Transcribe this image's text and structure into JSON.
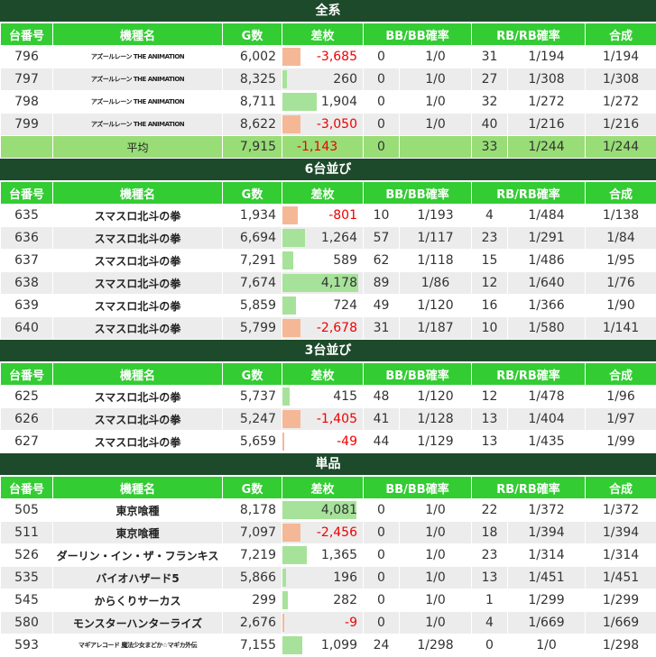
{
  "headers": [
    "台番号",
    "機種名",
    "G数",
    "差枚",
    "BB/BB確率",
    "RB/RB確率",
    "合成"
  ],
  "sections": [
    {
      "title": "全系",
      "rows": [
        {
          "no": "796",
          "name": "アズールレーン THE ANIMATION",
          "g": "6,002",
          "diff": "-3,685",
          "diff_value": -3685,
          "bb": "0",
          "bb_rate": "1/0",
          "rb": "31",
          "rb_rate": "1/194",
          "total": "1/194"
        },
        {
          "no": "797",
          "name": "アズールレーン THE ANIMATION",
          "g": "8,325",
          "diff": "260",
          "diff_value": 260,
          "bb": "0",
          "bb_rate": "1/0",
          "rb": "27",
          "rb_rate": "1/308",
          "total": "1/308"
        },
        {
          "no": "798",
          "name": "アズールレーン THE ANIMATION",
          "g": "8,711",
          "diff": "1,904",
          "diff_value": 1904,
          "bb": "0",
          "bb_rate": "1/0",
          "rb": "32",
          "rb_rate": "1/272",
          "total": "1/272"
        },
        {
          "no": "799",
          "name": "アズールレーン THE ANIMATION",
          "g": "8,622",
          "diff": "-3,050",
          "diff_value": -3050,
          "bb": "0",
          "bb_rate": "1/0",
          "rb": "40",
          "rb_rate": "1/216",
          "total": "1/216"
        }
      ],
      "average": {
        "label": "平均",
        "g": "7,915",
        "diff": "-1,143",
        "bb": "0",
        "rb": "33",
        "rb_rate": "1/244",
        "total": "1/244"
      }
    },
    {
      "title": "6台並び",
      "rows": [
        {
          "no": "635",
          "name": "スマスロ北斗の拳",
          "g": "1,934",
          "diff": "-801",
          "diff_value": -801,
          "bb": "10",
          "bb_rate": "1/193",
          "rb": "4",
          "rb_rate": "1/484",
          "total": "1/138"
        },
        {
          "no": "636",
          "name": "スマスロ北斗の拳",
          "g": "6,694",
          "diff": "1,264",
          "diff_value": 1264,
          "bb": "57",
          "bb_rate": "1/117",
          "rb": "23",
          "rb_rate": "1/291",
          "total": "1/84"
        },
        {
          "no": "637",
          "name": "スマスロ北斗の拳",
          "g": "7,291",
          "diff": "589",
          "diff_value": 589,
          "bb": "62",
          "bb_rate": "1/118",
          "rb": "15",
          "rb_rate": "1/486",
          "total": "1/95"
        },
        {
          "no": "638",
          "name": "スマスロ北斗の拳",
          "g": "7,674",
          "diff": "4,178",
          "diff_value": 4178,
          "bb": "89",
          "bb_rate": "1/86",
          "rb": "12",
          "rb_rate": "1/640",
          "total": "1/76"
        },
        {
          "no": "639",
          "name": "スマスロ北斗の拳",
          "g": "5,859",
          "diff": "724",
          "diff_value": 724,
          "bb": "49",
          "bb_rate": "1/120",
          "rb": "16",
          "rb_rate": "1/366",
          "total": "1/90"
        },
        {
          "no": "640",
          "name": "スマスロ北斗の拳",
          "g": "5,799",
          "diff": "-2,678",
          "diff_value": -2678,
          "bb": "31",
          "bb_rate": "1/187",
          "rb": "10",
          "rb_rate": "1/580",
          "total": "1/141"
        }
      ]
    },
    {
      "title": "3台並び",
      "rows": [
        {
          "no": "625",
          "name": "スマスロ北斗の拳",
          "g": "5,737",
          "diff": "415",
          "diff_value": 415,
          "bb": "48",
          "bb_rate": "1/120",
          "rb": "12",
          "rb_rate": "1/478",
          "total": "1/96"
        },
        {
          "no": "626",
          "name": "スマスロ北斗の拳",
          "g": "5,247",
          "diff": "-1,405",
          "diff_value": -1405,
          "bb": "41",
          "bb_rate": "1/128",
          "rb": "13",
          "rb_rate": "1/404",
          "total": "1/97"
        },
        {
          "no": "627",
          "name": "スマスロ北斗の拳",
          "g": "5,659",
          "diff": "-49",
          "diff_value": -49,
          "bb": "44",
          "bb_rate": "1/129",
          "rb": "13",
          "rb_rate": "1/435",
          "total": "1/99"
        }
      ]
    },
    {
      "title": "単品",
      "rows": [
        {
          "no": "505",
          "name": "東京喰種",
          "g": "8,178",
          "diff": "4,081",
          "diff_value": 4081,
          "bb": "0",
          "bb_rate": "1/0",
          "rb": "22",
          "rb_rate": "1/372",
          "total": "1/372"
        },
        {
          "no": "511",
          "name": "東京喰種",
          "g": "7,097",
          "diff": "-2,456",
          "diff_value": -2456,
          "bb": "0",
          "bb_rate": "1/0",
          "rb": "18",
          "rb_rate": "1/394",
          "total": "1/394"
        },
        {
          "no": "526",
          "name": "ダーリン・イン・ザ・フランキス",
          "g": "7,219",
          "diff": "1,365",
          "diff_value": 1365,
          "bb": "0",
          "bb_rate": "1/0",
          "rb": "23",
          "rb_rate": "1/314",
          "total": "1/314"
        },
        {
          "no": "535",
          "name": "バイオハザード5",
          "g": "5,866",
          "diff": "196",
          "diff_value": 196,
          "bb": "0",
          "bb_rate": "1/0",
          "rb": "13",
          "rb_rate": "1/451",
          "total": "1/451"
        },
        {
          "no": "545",
          "name": "からくりサーカス",
          "g": "299",
          "diff": "282",
          "diff_value": 282,
          "bb": "0",
          "bb_rate": "1/0",
          "rb": "1",
          "rb_rate": "1/299",
          "total": "1/299"
        },
        {
          "no": "580",
          "name": "モンスターハンターライズ",
          "g": "2,676",
          "diff": "-9",
          "diff_value": -9,
          "bb": "0",
          "bb_rate": "1/0",
          "rb": "4",
          "rb_rate": "1/669",
          "total": "1/669"
        },
        {
          "no": "593",
          "name": "マギアレコード 魔法少女まどか☆マギカ外伝",
          "g": "7,155",
          "diff": "1,099",
          "diff_value": 1099,
          "bb": "24",
          "bb_rate": "1/298",
          "rb": "0",
          "rb_rate": "1/0",
          "total": "1/298"
        }
      ]
    }
  ],
  "colors": {
    "section_bg": "#1d4a2b",
    "header_bg": "#33cc33",
    "avg_bg": "#99dd77",
    "row_even": "#ececec",
    "bar_positive": "#a6e29a",
    "bar_negative": "#f4b897",
    "negative_text": "#ee0000"
  }
}
